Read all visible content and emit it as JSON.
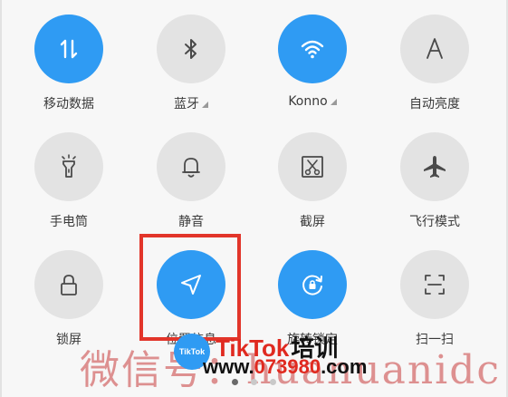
{
  "tiles": [
    {
      "id": "mobile-data",
      "label": "移动数据",
      "icon": "mobile-data-icon",
      "active": true,
      "caret": false
    },
    {
      "id": "bluetooth",
      "label": "蓝牙",
      "icon": "bluetooth-icon",
      "active": false,
      "caret": true
    },
    {
      "id": "wifi",
      "label": "Konno",
      "icon": "wifi-icon",
      "active": true,
      "caret": true
    },
    {
      "id": "auto-brightness",
      "label": "自动亮度",
      "icon": "brightness-a-icon",
      "active": false,
      "caret": false
    },
    {
      "id": "flashlight",
      "label": "手电筒",
      "icon": "flashlight-icon",
      "active": false,
      "caret": false
    },
    {
      "id": "silent",
      "label": "静音",
      "icon": "bell-icon",
      "active": false,
      "caret": false
    },
    {
      "id": "screenshot",
      "label": "截屏",
      "icon": "scissors-icon",
      "active": false,
      "caret": false
    },
    {
      "id": "airplane",
      "label": "飞行模式",
      "icon": "airplane-icon",
      "active": false,
      "caret": false
    },
    {
      "id": "lock-screen",
      "label": "锁屏",
      "icon": "lock-icon",
      "active": false,
      "caret": false
    },
    {
      "id": "location",
      "label": "位置信息",
      "icon": "location-arrow-icon",
      "active": true,
      "caret": false
    },
    {
      "id": "rotation-lock",
      "label": "旋转锁定",
      "icon": "rotation-lock-icon",
      "active": true,
      "caret": false
    },
    {
      "id": "scan",
      "label": "扫一扫",
      "icon": "scan-icon",
      "active": false,
      "caret": false
    }
  ],
  "watermark": {
    "cn_text": "微信号：huanuanidc",
    "brand": "TikTok",
    "brand_cn": "培训",
    "site_prefix": "www.",
    "site_num": "073980",
    "site_suffix": ".com",
    "logo_text": "TikTok"
  },
  "pager": {
    "count": 3,
    "active_index": 0
  },
  "colors": {
    "active": "#2f9bf3",
    "inactive": "#e3e3e3",
    "highlight": "#e2352a",
    "icon_dark": "#4a4a4a"
  }
}
